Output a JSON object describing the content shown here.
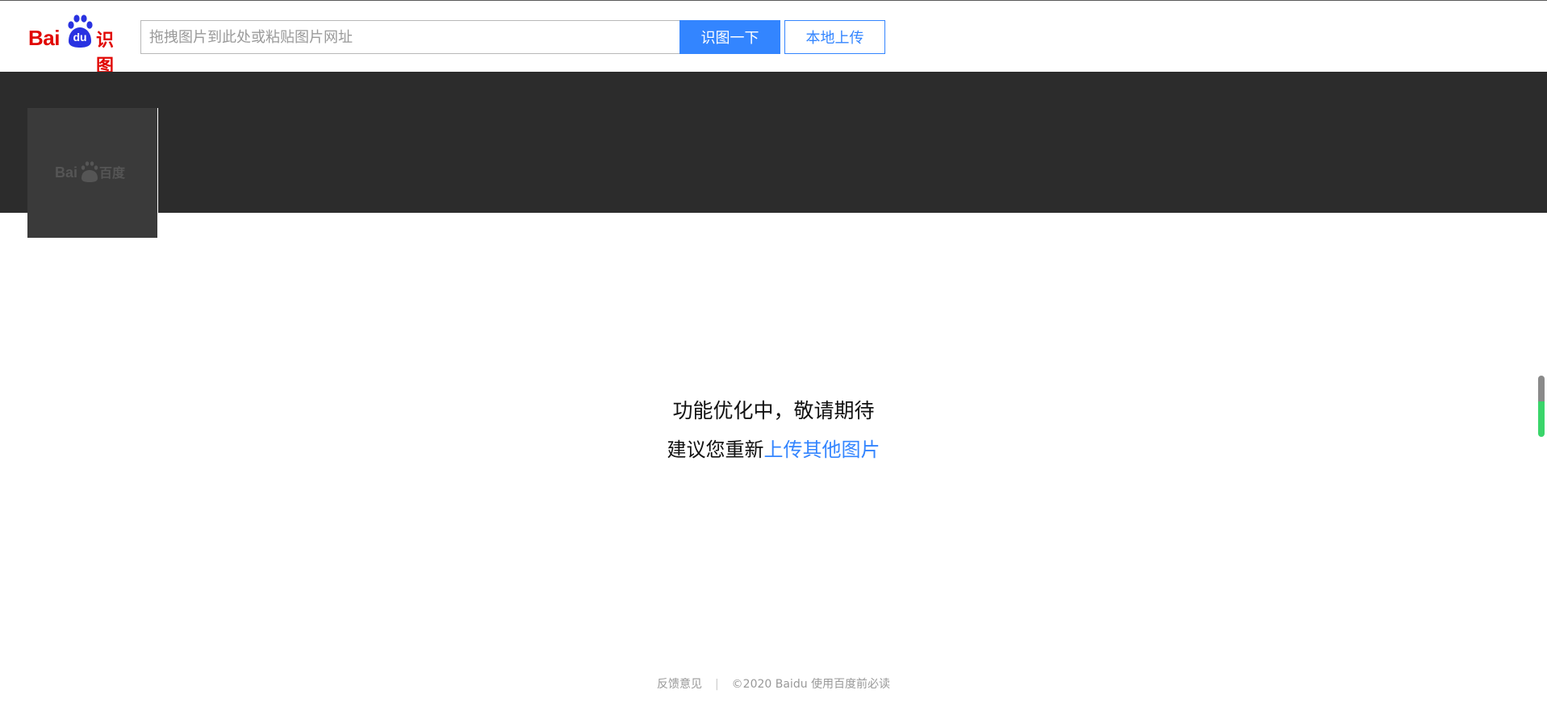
{
  "header": {
    "logo": {
      "brand_text": "Bai",
      "paw_text": "du",
      "product_text": "识图"
    },
    "search": {
      "placeholder": "拖拽图片到此处或粘贴图片网址",
      "value": ""
    },
    "search_button": "识图一下",
    "upload_button": "本地上传"
  },
  "thumbnail": {
    "watermark_text": "Bai百度"
  },
  "message": {
    "title": "功能优化中，敬请期待",
    "suggestion_prefix": "建议您重新",
    "suggestion_link": "上传其他图片"
  },
  "footer": {
    "feedback": "反馈意见",
    "separator": "|",
    "copyright": "©2020 Baidu 使用百度前必读"
  },
  "colors": {
    "brand_red": "#e10602",
    "brand_blue": "#2932e1",
    "accent_blue": "#3385ff",
    "banner_dark": "#2c2c2c"
  }
}
